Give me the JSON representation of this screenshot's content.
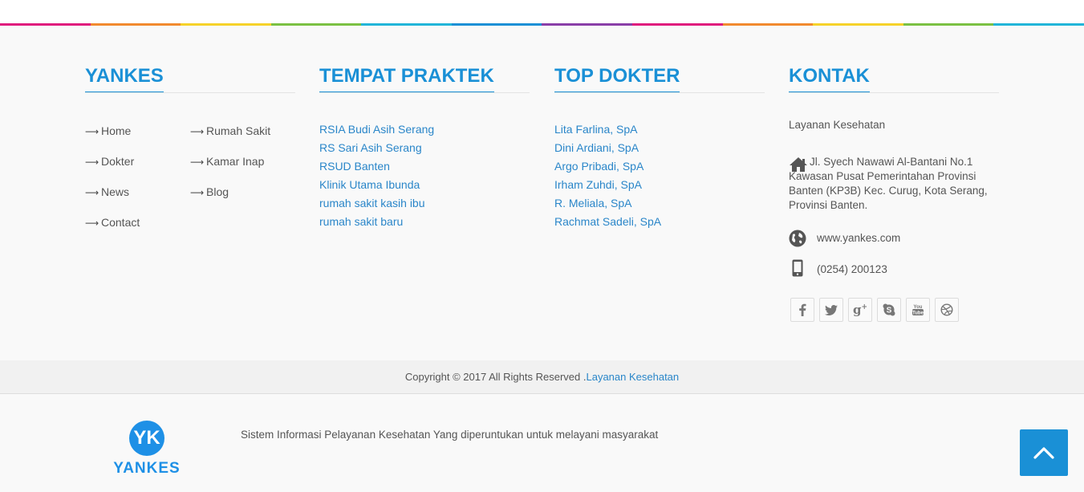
{
  "stripe_colors": [
    "#e0197d",
    "#f18a2f",
    "#f6d22a",
    "#7bc143",
    "#22b5d9",
    "#1a90d6",
    "#8a3fa8",
    "#e0197d",
    "#f18a2f",
    "#f6d22a",
    "#7bc143",
    "#22b5d9"
  ],
  "accent": "#1a90d6",
  "yankes": {
    "title": "YANKES",
    "items": [
      {
        "label": "Home",
        "icon": "arrow-right-icon"
      },
      {
        "label": "Rumah Sakit",
        "icon": "arrow-right-icon"
      },
      {
        "label": "Dokter",
        "icon": "arrow-right-icon"
      },
      {
        "label": "Kamar Inap",
        "icon": "arrow-right-icon"
      },
      {
        "label": "News",
        "icon": "arrow-right-icon"
      },
      {
        "label": "Blog",
        "icon": "arrow-right-icon"
      },
      {
        "label": "Contact",
        "icon": "arrow-right-icon"
      }
    ]
  },
  "tempat": {
    "title": "TEMPAT PRAKTEK",
    "items": [
      "RSIA Budi Asih Serang",
      "RS Sari Asih Serang",
      "RSUD Banten",
      "Klinik Utama Ibunda",
      "rumah sakit kasih ibu",
      "rumah sakit baru"
    ]
  },
  "dokter": {
    "title": "TOP DOKTER",
    "items": [
      "Lita Farlina, SpA",
      "Dini Ardiani, SpA",
      "Argo Pribadi, SpA",
      "Irham Zuhdi, SpA",
      "R. Meliala, SpA",
      "Rachmat Sadeli, SpA"
    ]
  },
  "kontak": {
    "title": "KONTAK",
    "name": "Layanan Kesehatan",
    "address": "Jl. Syech Nawawi Al-Bantani No.1 Kawasan Pusat Pemerintahan Provinsi Banten (KP3B) Kec. Curug, Kota Serang, Provinsi Banten.",
    "website": "www.yankes.com",
    "phone": "(0254) 200123",
    "icons": [
      "home-icon",
      "globe-icon",
      "phone-icon"
    ],
    "social": [
      "facebook-icon",
      "twitter-icon",
      "google-plus-icon",
      "skype-icon",
      "youtube-icon",
      "dribbble-icon"
    ]
  },
  "copyright": {
    "text": "Copyright © 2017 All Rights Reserved .",
    "link": "Layanan Kesehatan"
  },
  "logo": {
    "initials": "YK",
    "word": "YANKES"
  },
  "tagline": "Sistem Informasi Pelayanan Kesehatan Yang diperuntukan untuk melayani masyarakat",
  "back_to_top_icon": "chevron-up-icon"
}
